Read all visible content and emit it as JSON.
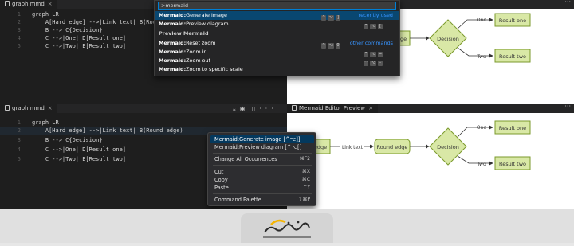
{
  "top": {
    "tab_label": "graph.mmd",
    "code_lines": [
      {
        "n": "1",
        "text": "graph LR"
      },
      {
        "n": "2",
        "text": "    A[Hard edge] -->|Link text| B(Roun"
      },
      {
        "n": "3",
        "text": "    B --> C{Decision}"
      },
      {
        "n": "4",
        "text": "    C -->|One| D[Result one]"
      },
      {
        "n": "5",
        "text": "    C -->|Two| E[Result two]"
      }
    ],
    "palette": {
      "input_value": ">mermaid",
      "group_title": "Preview Mermaid",
      "items": [
        {
          "prefix": "Mermaid:",
          "label": "Generate image",
          "keys": [
            "^",
            "⌥",
            "]"
          ],
          "hint": "recently used",
          "selected": true
        },
        {
          "prefix": "Mermaid:",
          "label": "Preview diagram",
          "keys": [
            "^",
            "⌥",
            "["
          ],
          "hint": "",
          "selected": false
        },
        {
          "prefix": "Mermaid:",
          "label": "Reset zoom",
          "keys": [
            "^",
            "⌥",
            "0"
          ],
          "hint": "other commands",
          "selected": false
        },
        {
          "prefix": "Mermaid:",
          "label": "Zoom in",
          "keys": [
            "^",
            "⌥",
            "="
          ],
          "hint": "",
          "selected": false
        },
        {
          "prefix": "Mermaid:",
          "label": "Zoom out",
          "keys": [
            "^",
            "⌥",
            "-"
          ],
          "hint": "",
          "selected": false
        },
        {
          "prefix": "Mermaid:",
          "label": "Zoom to specific scale",
          "keys": [],
          "hint": "",
          "selected": false
        }
      ]
    },
    "diagram": {
      "edge_text": "edge",
      "decision": "Decision",
      "one": "One",
      "two": "Two",
      "result_one": "Result one",
      "result_two": "Result two"
    }
  },
  "bottom": {
    "tab_label": "graph.mmd",
    "preview_tab_label": "Mermaid Editor Preview",
    "code_lines": [
      {
        "n": "1",
        "text": "graph LR"
      },
      {
        "n": "2",
        "text": "    A[Hard edge] -->|Link text| B(Round edge)"
      },
      {
        "n": "3",
        "text": "    B --> C{Decision}"
      },
      {
        "n": "4",
        "text": "    C -->|One| D[Result one]"
      },
      {
        "n": "5",
        "text": "    C -->|Two| E[Result two]"
      }
    ],
    "context_menu": {
      "items": [
        {
          "label": "Mermaid:Generate image [^⌥]]",
          "key": "",
          "selected": true
        },
        {
          "label": "Mermaid:Preview diagram [^⌥[]",
          "key": "",
          "selected": false
        },
        {
          "label": "Change All Occurrences",
          "key": "⌘F2",
          "selected": false
        },
        {
          "label": "Cut",
          "key": "⌘X",
          "selected": false
        },
        {
          "label": "Copy",
          "key": "⌘C",
          "selected": false
        },
        {
          "label": "Paste",
          "key": "^Y",
          "selected": false
        },
        {
          "label": "Command Palette...",
          "key": "⇧⌘P",
          "selected": false
        }
      ]
    },
    "diagram": {
      "hard_edge": "edge",
      "link_text": "Link text",
      "round_edge": "Round edge",
      "decision": "Decision",
      "one": "One",
      "two": "Two",
      "result_one": "Result one",
      "result_two": "Result two"
    }
  },
  "colors": {
    "node_fill": "#d9e8a6",
    "node_stroke": "#7b9a2c",
    "selection": "#094771",
    "link": "#3794ff"
  }
}
